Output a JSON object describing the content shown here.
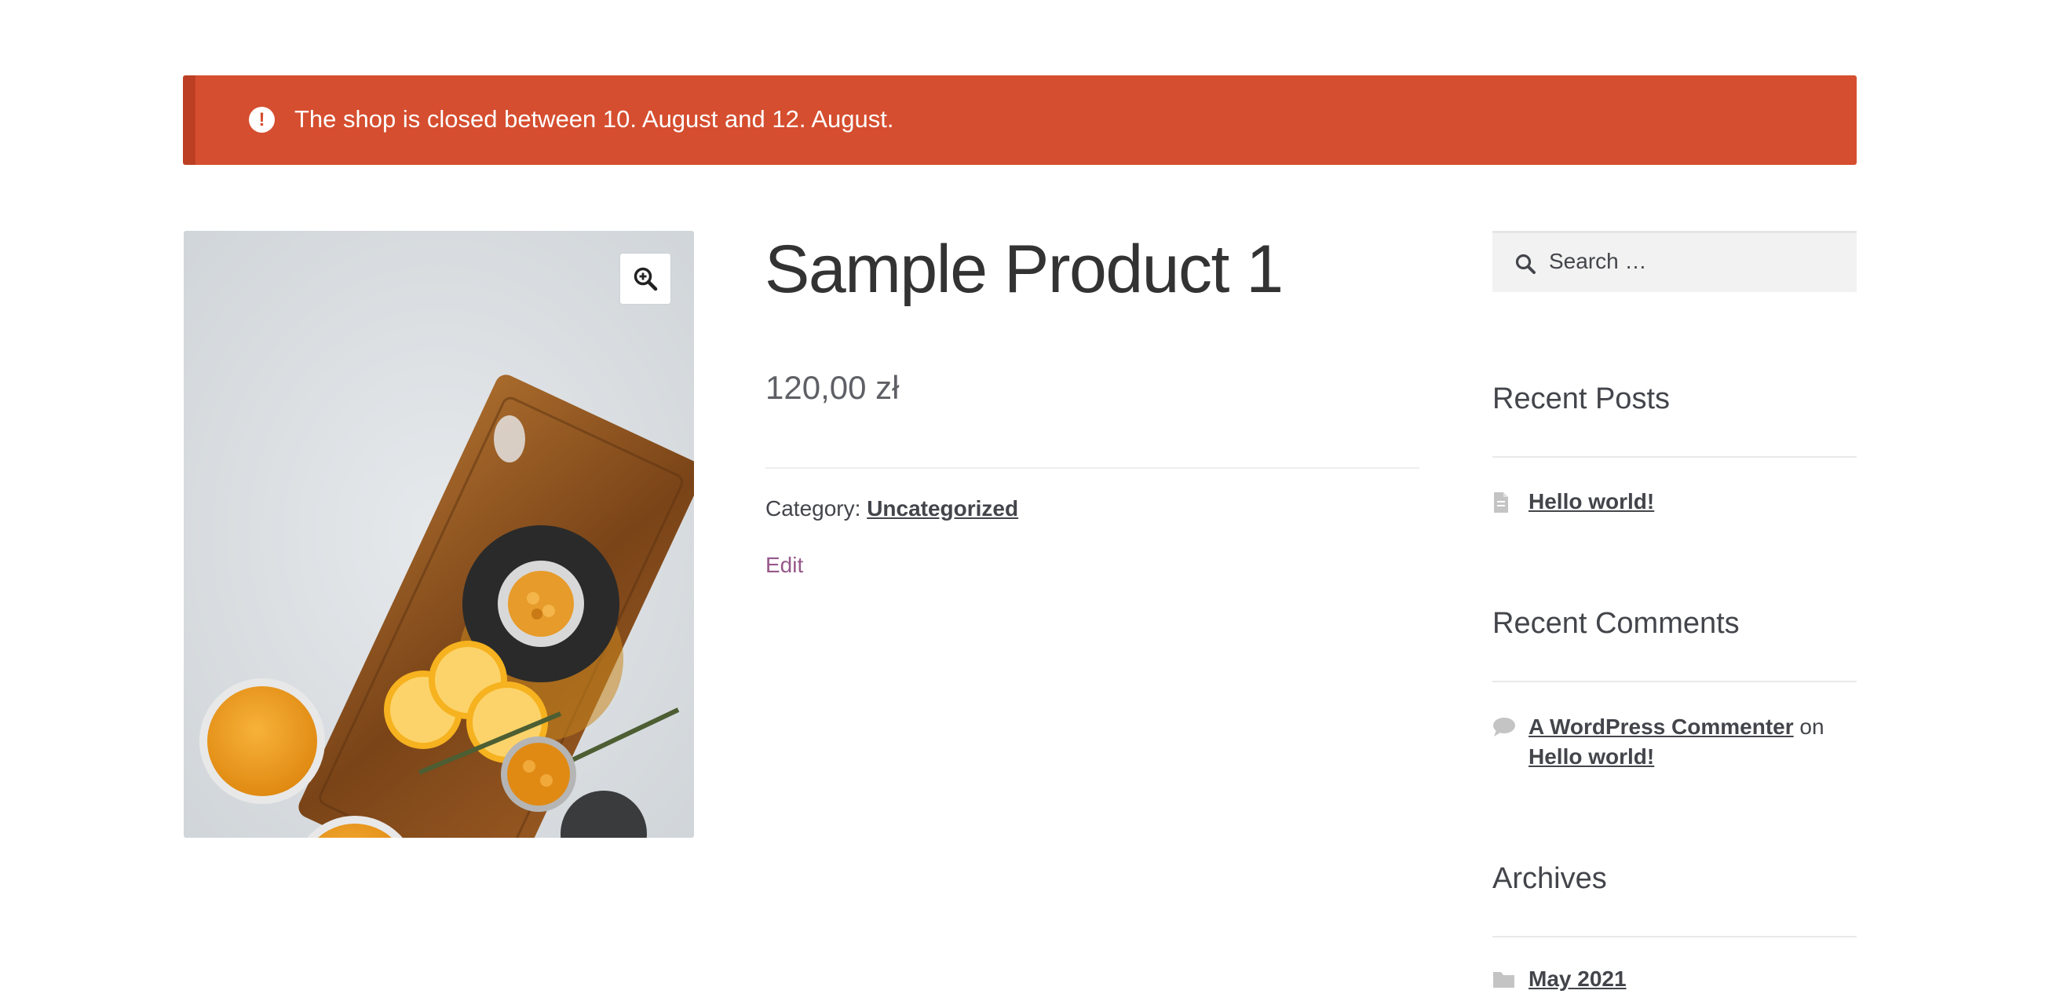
{
  "notice": {
    "icon": "exclamation-circle-icon",
    "text": "The shop is closed between 10. August and 12. August.",
    "background_color": "#d54e2f"
  },
  "product": {
    "zoom_icon": "zoom-in-icon",
    "title": "Sample Product 1",
    "price": "120,00 zł",
    "category_label": "Category:",
    "category_link": "Uncategorized",
    "edit_label": "Edit"
  },
  "sidebar": {
    "search": {
      "icon": "search-icon",
      "placeholder": "Search …"
    },
    "recent_posts": {
      "title": "Recent Posts",
      "items": [
        {
          "icon": "document-icon",
          "label": "Hello world!"
        }
      ]
    },
    "recent_comments": {
      "title": "Recent Comments",
      "items": [
        {
          "icon": "comment-icon",
          "author": "A WordPress Commenter",
          "connector": "on",
          "post": "Hello world!"
        }
      ]
    },
    "archives": {
      "title": "Archives",
      "items": [
        {
          "icon": "folder-icon",
          "label": "May 2021"
        }
      ]
    }
  },
  "colors": {
    "accent_link": "#96588a",
    "text": "#43454b"
  }
}
